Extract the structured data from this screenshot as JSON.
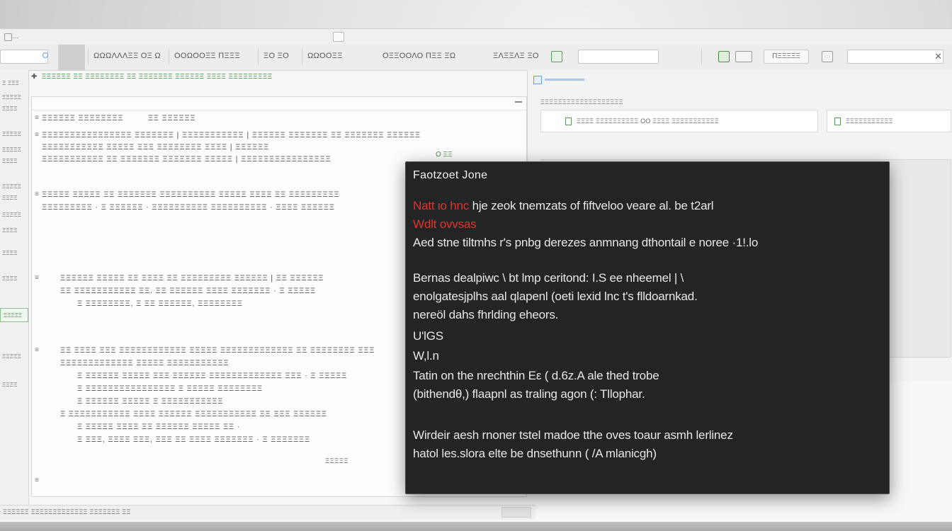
{
  "window": {
    "app_label": "...",
    "colors": {
      "accent_green": "#3b8a3b",
      "popup_bg": "#222426",
      "popup_red": "#e0362c"
    }
  },
  "toolbar": {
    "search_value": "",
    "items": [
      "ΩΩΩΛΛΛΞΞ ΟΞ Ω",
      "ΟΟΩΟΟΞΞ ΠΞΞΞ",
      "ΞΟ ΞΟ",
      "ΩΩΟΟΞΞ",
      "ΟΞΞΟΟΛΟ ΠΞΞ ΞΩ",
      "ΞΛΞΞΛΞ ΞΟ"
    ],
    "filter_value": "",
    "filter_button": "ΠΞΞΞΞΞ",
    "right_field_value": ""
  },
  "leftrail": {
    "items": [
      "Ξ ΞΞΞ",
      "ΞΞΞΞΞ",
      "ΞΞΞΞ",
      "ΞΞΞΞΞ",
      "ΞΞΞΞΞ",
      "ΞΞΞΞ",
      "ΞΞΞΞΞ",
      "ΞΞΞΞ",
      "ΞΞΞΞΞ",
      "ΞΞΞΞ",
      "ΞΞΞΞ",
      "ΞΞΞΞ",
      "ΞΞΞΞΞ",
      "ΞΞΞΞ"
    ],
    "active_box": "ΞΞΞΞΞ"
  },
  "breadcrumb": "ΞΞΞΞΞΞ ΞΞ ΞΞΞΞΞΞΞΞ ΞΞ ΞΞΞΞΞΞΞ  ΞΞΞΞΞΞ ΞΞΞΞ ΞΞΞΞΞΞΞΞΞ",
  "editor": {
    "paragraphs": [
      "ΞΞΞΞΞΞ ΞΞΞΞΞΞΞΞ         ΞΞ ΞΞΞΞΞΞ",
      "ΞΞΞΞΞΞΞΞΞΞΞΞΞΞΞΞ ΞΞΞΞΞΞΞ | ΞΞΞΞΞΞΞΞΞΞΞ | ΞΞΞΞΞΞ ΞΞΞΞΞΞΞ ΞΞ ΞΞΞΞΞΞΞ ΞΞΞΞΞΞ",
      "ΞΞΞΞΞΞΞΞΞΞΞ ΞΞΞΞΞ ΞΞΞ ΞΞΞΞΞΞΞΞ ΞΞΞΞ | ΞΞΞΞΞΞ",
      "ΞΞΞΞΞΞΞΞΞΞΞ ΞΞ ΞΞΞΞΞΞΞ ΞΞΞΞΞΞΞ ΞΞΞΞΞ | ΞΞΞΞΞΞΞΞΞΞΞΞΞΞΞΞ",
      "ΞΞΞΞΞ ΞΞΞΞΞ ΞΞ ΞΞΞΞΞΞΞ ΞΞΞΞΞΞΞΞΞΞ ΞΞΞΞΞ ΞΞΞΞ ΞΞ ΞΞΞΞΞΞΞΞΞ",
      "ΞΞΞΞΞΞΞΞΞ · Ξ ΞΞΞΞΞΞ · ΞΞΞΞΞΞΞΞΞΞ ΞΞΞΞΞΞΞΞΞΞ · ΞΞΞΞ ΞΞΞΞΞΞ",
      "ΞΞΞΞΞΞ ΞΞΞΞΞ ΞΞ ΞΞΞΞ ΞΞ ΞΞΞΞΞΞΞΞΞ ΞΞΞΞΞΞ | ΞΞ ΞΞΞΞΞΞ",
      "ΞΞ ΞΞΞΞΞΞΞΞΞΞΞ ΞΞ. ΞΞ ΞΞΞΞΞΞ ΞΞΞΞ ΞΞΞΞΞΞΞ · Ξ ΞΞΞΞΞ",
      "Ξ ΞΞΞΞΞΞΞΞ, Ξ ΞΞ ΞΞΞΞΞΞ, ΞΞΞΞΞΞΞΞ",
      "ΞΞ ΞΞΞΞ ΞΞΞ ΞΞΞΞΞΞΞΞΞΞΞΞ ΞΞΞΞΞ ΞΞΞΞΞΞΞΞΞΞΞΞΞ ΞΞ ΞΞΞΞΞΞΞΞ ΞΞΞ",
      "ΞΞΞΞΞΞΞΞΞΞΞΞΞ ΞΞΞΞΞ ΞΞΞΞΞΞΞΞΞΞΞ",
      "Ξ ΞΞΞΞΞΞ ΞΞΞΞΞ ΞΞΞ ΞΞΞΞΞΞ ΞΞΞΞΞΞΞΞΞΞΞΞΞ ΞΞΞ · Ξ ΞΞΞΞΞ",
      "Ξ ΞΞΞΞΞΞΞΞΞΞΞΞΞΞΞΞ Ξ ΞΞΞΞΞ ΞΞΞΞΞΞΞΞ",
      "Ξ ΞΞΞΞΞΞ ΞΞΞΞΞ Ξ ΞΞΞΞΞΞΞΞΞΞΞ",
      "Ξ ΞΞΞΞΞΞΞΞΞΞΞ ΞΞΞΞ ΞΞΞΞΞΞ ΞΞΞΞΞΞΞΞΞΞΞ ΞΞ ΞΞΞ ΞΞΞΞΞΞ",
      "Ξ ΞΞΞΞΞ ΞΞΞΞ ΞΞ ΞΞΞΞΞΞ ΞΞΞΞΞ ΞΞ ·",
      "Ξ ΞΞΞ, ΞΞΞΞ ΞΞΞ, ΞΞΞ ΞΞ ΞΞΞΞ ΞΞΞΞΞΞΞ · Ξ ΞΞΞΞΞΞΞ",
      "ΞΞΞΞΞ"
    ],
    "marker": "Ο ΞΞ"
  },
  "rightpane": {
    "header": "ΞΞΞΞΞΞΞΞΞΞΞΞΞΞΞΞΞΞΞ",
    "card_left_label": "ΞΞΞΞ ΞΞΞΞΞΞΞΞΞΞ  ΟΟ ΞΞΞΞ  ΞΞΞΞΞΞΞΞΞΞΞ",
    "card_right_label": "ΞΞΞΞΞΞΞΞΞΞΞ"
  },
  "statusbar": {
    "text": "ΞΞΞΞΞΞ ΞΞΞΞΞΞΞΞΞΞΞΞΞ ΞΞΞΞΞΞΞ ΞΞ"
  },
  "popup": {
    "title": "Faotzoet Jone",
    "lines": [
      {
        "red": "Natt ιo hnc",
        "rest": "  hje zeok tnemzats of fiftveloo veare al. be t2arl"
      },
      {
        "red": "Wdlt ovvsas",
        "rest": ""
      },
      {
        "text": "Aed stne tiltmhs r's pnbg derezes anmnang dthontail e noree ·1!.lo"
      },
      {
        "text": "Bernas dealpiwc \\ bt lmp ceritond:  I.S ee nheemel |  \\"
      },
      {
        "text": "enolgatesjplhs aal qlapenl (oeti lexid lnc t's flldoarnkad."
      },
      {
        "text": "nereöl dahs fhrlding eheors."
      },
      {
        "text": "U'lGS"
      },
      {
        "text": "W,l.n"
      },
      {
        "text": "Tatin on the nrechthin Eε ( d.6z.A  ale thed trobe"
      },
      {
        "text": "(bithendθ,) flaapnl as traling agon  (: Tllophar."
      },
      {
        "text": "Wirdeir aesh rnoner tstel madoe tthe oves toaur asmh lerlinez"
      },
      {
        "text": "hatol les.slora elte be dnsethunn ( /A mlanicgh)"
      }
    ]
  }
}
